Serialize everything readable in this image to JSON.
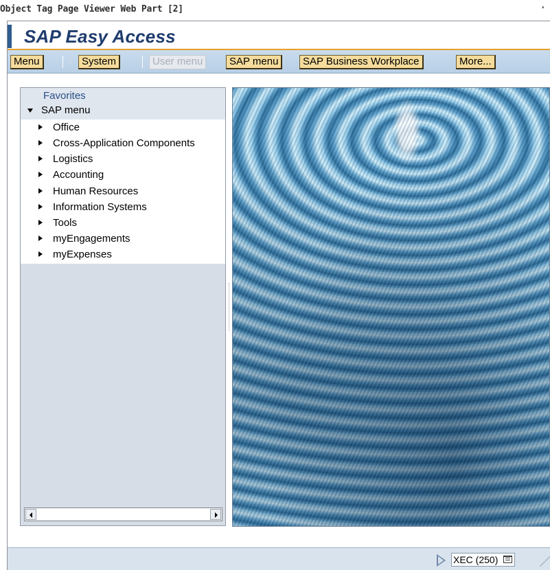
{
  "webpart": {
    "title": "Object Tag Page Viewer Web Part [2]",
    "menu_arrow": "▾"
  },
  "app": {
    "title": "SAP Easy Access"
  },
  "toolbar": {
    "menu": "Menu",
    "system": "System",
    "user_menu": "User menu",
    "sap_menu": "SAP menu",
    "business_workplace": "SAP Business Workplace",
    "more": "More..."
  },
  "tree": {
    "favorites": "Favorites",
    "root": "SAP menu",
    "items": [
      {
        "label": "Office"
      },
      {
        "label": "Cross-Application Components"
      },
      {
        "label": "Logistics"
      },
      {
        "label": "Accounting"
      },
      {
        "label": "Human Resources"
      },
      {
        "label": "Information Systems"
      },
      {
        "label": "Tools"
      },
      {
        "label": "myEngagements"
      },
      {
        "label": "myExpenses"
      }
    ]
  },
  "status": {
    "system": "XEC (250)"
  },
  "colors": {
    "accent": "#2f5d8f",
    "title": "#1f3c6e",
    "orange_rule": "#e89e2b",
    "button": "#f5dc9c",
    "toolbar": "#c9dced"
  }
}
